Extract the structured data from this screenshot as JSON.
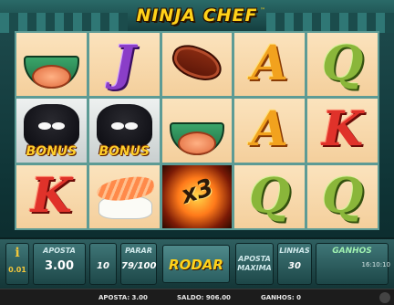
{
  "game": {
    "title": "NINJA CHEF",
    "trademark": "™"
  },
  "reels": [
    [
      "soup",
      "bonus",
      "K"
    ],
    [
      "J",
      "bonus",
      "sushi"
    ],
    [
      "steak",
      "soup",
      "x3"
    ],
    [
      "A",
      "A",
      "Q"
    ],
    [
      "Q",
      "K",
      "Q"
    ]
  ],
  "symbols": {
    "bonus_label": "BONUS",
    "multiplier_label": "x3",
    "letters": {
      "A": "A",
      "Q": "Q",
      "K": "K",
      "J": "J"
    }
  },
  "controls": {
    "info_icon": "i",
    "coin_value": "0.01",
    "aposta_label": "APOSTA",
    "aposta_value": "3.00",
    "linhas_selector_value": "10",
    "parar_label": "PARAR",
    "parar_value": "79/100",
    "rodar_label": "RODAR",
    "aposta_maxima_label": "APOSTA MAXIMA",
    "linhas_label": "LINHAS",
    "linhas_value": "30",
    "ganhos_label": "GANHOS"
  },
  "clock": "16:10:10",
  "status": {
    "aposta": "APOSTA: 3.00",
    "saldo": "SALDO: 906.00",
    "ganhos": "GANHOS: 0"
  },
  "colors": {
    "logo": "#ffd21a",
    "frame": "#0f3436",
    "reel_bg": "#f4cf9c",
    "rodar_text": "#ffd21a"
  }
}
